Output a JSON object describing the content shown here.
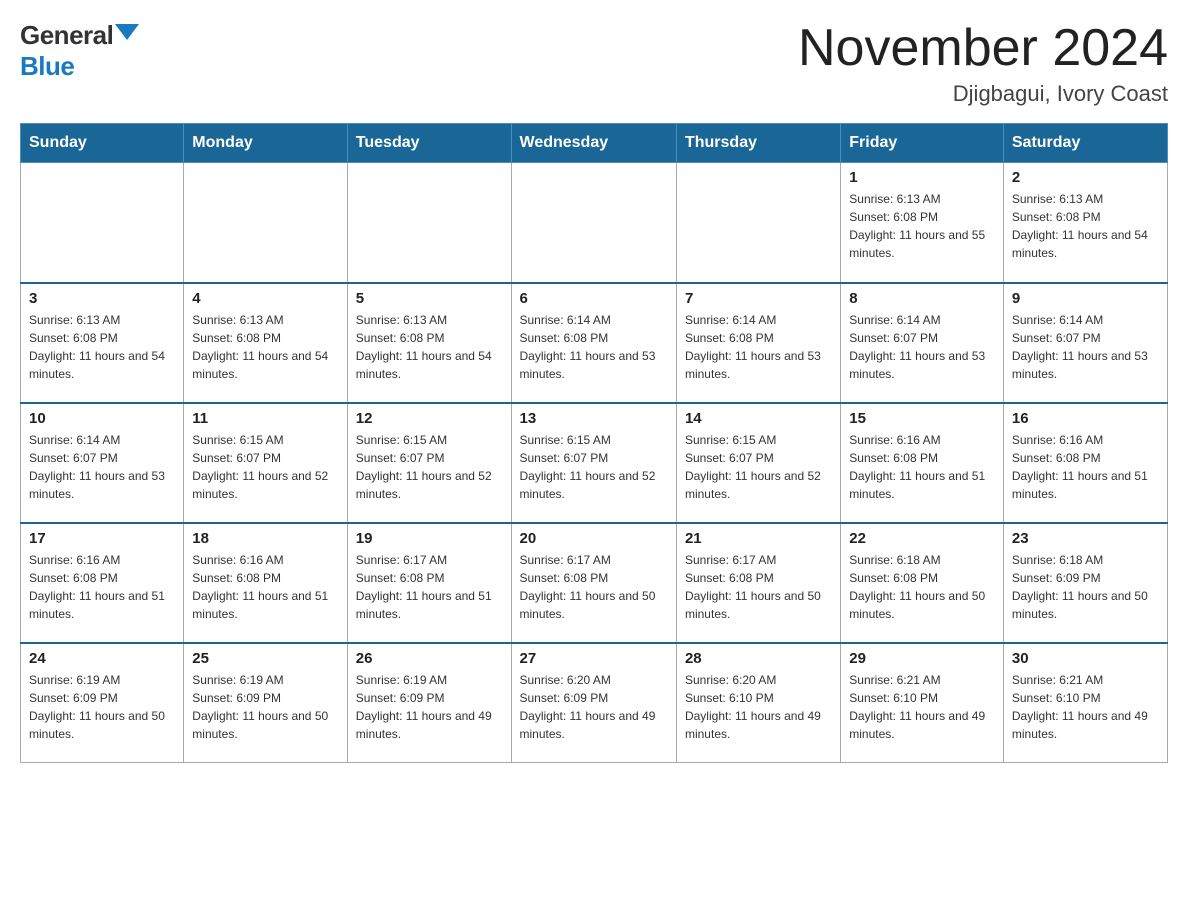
{
  "header": {
    "logo_general": "General",
    "logo_blue": "Blue",
    "month_title": "November 2024",
    "location": "Djigbagui, Ivory Coast"
  },
  "weekdays": [
    "Sunday",
    "Monday",
    "Tuesday",
    "Wednesday",
    "Thursday",
    "Friday",
    "Saturday"
  ],
  "weeks": [
    [
      {
        "day": "",
        "info": ""
      },
      {
        "day": "",
        "info": ""
      },
      {
        "day": "",
        "info": ""
      },
      {
        "day": "",
        "info": ""
      },
      {
        "day": "",
        "info": ""
      },
      {
        "day": "1",
        "info": "Sunrise: 6:13 AM\nSunset: 6:08 PM\nDaylight: 11 hours and 55 minutes."
      },
      {
        "day": "2",
        "info": "Sunrise: 6:13 AM\nSunset: 6:08 PM\nDaylight: 11 hours and 54 minutes."
      }
    ],
    [
      {
        "day": "3",
        "info": "Sunrise: 6:13 AM\nSunset: 6:08 PM\nDaylight: 11 hours and 54 minutes."
      },
      {
        "day": "4",
        "info": "Sunrise: 6:13 AM\nSunset: 6:08 PM\nDaylight: 11 hours and 54 minutes."
      },
      {
        "day": "5",
        "info": "Sunrise: 6:13 AM\nSunset: 6:08 PM\nDaylight: 11 hours and 54 minutes."
      },
      {
        "day": "6",
        "info": "Sunrise: 6:14 AM\nSunset: 6:08 PM\nDaylight: 11 hours and 53 minutes."
      },
      {
        "day": "7",
        "info": "Sunrise: 6:14 AM\nSunset: 6:08 PM\nDaylight: 11 hours and 53 minutes."
      },
      {
        "day": "8",
        "info": "Sunrise: 6:14 AM\nSunset: 6:07 PM\nDaylight: 11 hours and 53 minutes."
      },
      {
        "day": "9",
        "info": "Sunrise: 6:14 AM\nSunset: 6:07 PM\nDaylight: 11 hours and 53 minutes."
      }
    ],
    [
      {
        "day": "10",
        "info": "Sunrise: 6:14 AM\nSunset: 6:07 PM\nDaylight: 11 hours and 53 minutes."
      },
      {
        "day": "11",
        "info": "Sunrise: 6:15 AM\nSunset: 6:07 PM\nDaylight: 11 hours and 52 minutes."
      },
      {
        "day": "12",
        "info": "Sunrise: 6:15 AM\nSunset: 6:07 PM\nDaylight: 11 hours and 52 minutes."
      },
      {
        "day": "13",
        "info": "Sunrise: 6:15 AM\nSunset: 6:07 PM\nDaylight: 11 hours and 52 minutes."
      },
      {
        "day": "14",
        "info": "Sunrise: 6:15 AM\nSunset: 6:07 PM\nDaylight: 11 hours and 52 minutes."
      },
      {
        "day": "15",
        "info": "Sunrise: 6:16 AM\nSunset: 6:08 PM\nDaylight: 11 hours and 51 minutes."
      },
      {
        "day": "16",
        "info": "Sunrise: 6:16 AM\nSunset: 6:08 PM\nDaylight: 11 hours and 51 minutes."
      }
    ],
    [
      {
        "day": "17",
        "info": "Sunrise: 6:16 AM\nSunset: 6:08 PM\nDaylight: 11 hours and 51 minutes."
      },
      {
        "day": "18",
        "info": "Sunrise: 6:16 AM\nSunset: 6:08 PM\nDaylight: 11 hours and 51 minutes."
      },
      {
        "day": "19",
        "info": "Sunrise: 6:17 AM\nSunset: 6:08 PM\nDaylight: 11 hours and 51 minutes."
      },
      {
        "day": "20",
        "info": "Sunrise: 6:17 AM\nSunset: 6:08 PM\nDaylight: 11 hours and 50 minutes."
      },
      {
        "day": "21",
        "info": "Sunrise: 6:17 AM\nSunset: 6:08 PM\nDaylight: 11 hours and 50 minutes."
      },
      {
        "day": "22",
        "info": "Sunrise: 6:18 AM\nSunset: 6:08 PM\nDaylight: 11 hours and 50 minutes."
      },
      {
        "day": "23",
        "info": "Sunrise: 6:18 AM\nSunset: 6:09 PM\nDaylight: 11 hours and 50 minutes."
      }
    ],
    [
      {
        "day": "24",
        "info": "Sunrise: 6:19 AM\nSunset: 6:09 PM\nDaylight: 11 hours and 50 minutes."
      },
      {
        "day": "25",
        "info": "Sunrise: 6:19 AM\nSunset: 6:09 PM\nDaylight: 11 hours and 50 minutes."
      },
      {
        "day": "26",
        "info": "Sunrise: 6:19 AM\nSunset: 6:09 PM\nDaylight: 11 hours and 49 minutes."
      },
      {
        "day": "27",
        "info": "Sunrise: 6:20 AM\nSunset: 6:09 PM\nDaylight: 11 hours and 49 minutes."
      },
      {
        "day": "28",
        "info": "Sunrise: 6:20 AM\nSunset: 6:10 PM\nDaylight: 11 hours and 49 minutes."
      },
      {
        "day": "29",
        "info": "Sunrise: 6:21 AM\nSunset: 6:10 PM\nDaylight: 11 hours and 49 minutes."
      },
      {
        "day": "30",
        "info": "Sunrise: 6:21 AM\nSunset: 6:10 PM\nDaylight: 11 hours and 49 minutes."
      }
    ]
  ]
}
